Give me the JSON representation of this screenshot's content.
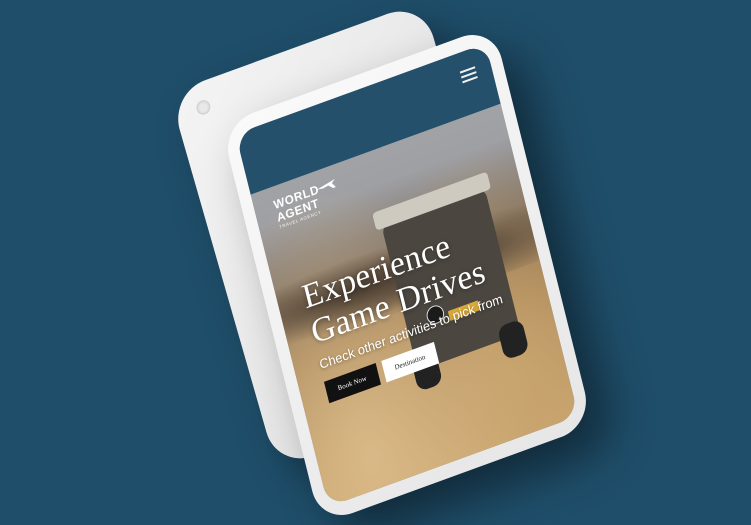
{
  "background_color": "#1f4e6a",
  "navbar": {
    "bg_color": "#24506b",
    "menu_icon": "hamburger-menu-icon"
  },
  "logo": {
    "line1": "WORLD",
    "line2": "AGENT",
    "tagline": "TRAVEL AGENCY",
    "icon": "airplane-icon"
  },
  "hero": {
    "title_line1": "Experience",
    "title_line2": "Game Drives",
    "subtitle": "Check other activities to pick from",
    "primary_button": "Book Now",
    "secondary_button": "Destination"
  }
}
